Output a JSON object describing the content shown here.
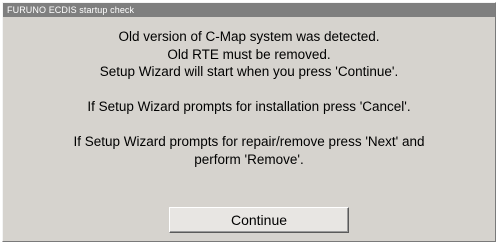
{
  "window": {
    "title": "FURUNO ECDIS startup check"
  },
  "message": {
    "lines": [
      "Old version of C-Map system was detected.",
      "Old RTE must be removed.",
      "Setup Wizard will start when you press 'Continue'.",
      "",
      "If Setup Wizard prompts for installation press 'Cancel'.",
      "",
      "If Setup Wizard prompts for repair/remove press 'Next' and",
      "perform 'Remove'."
    ]
  },
  "buttons": {
    "continue_label": "Continue"
  }
}
